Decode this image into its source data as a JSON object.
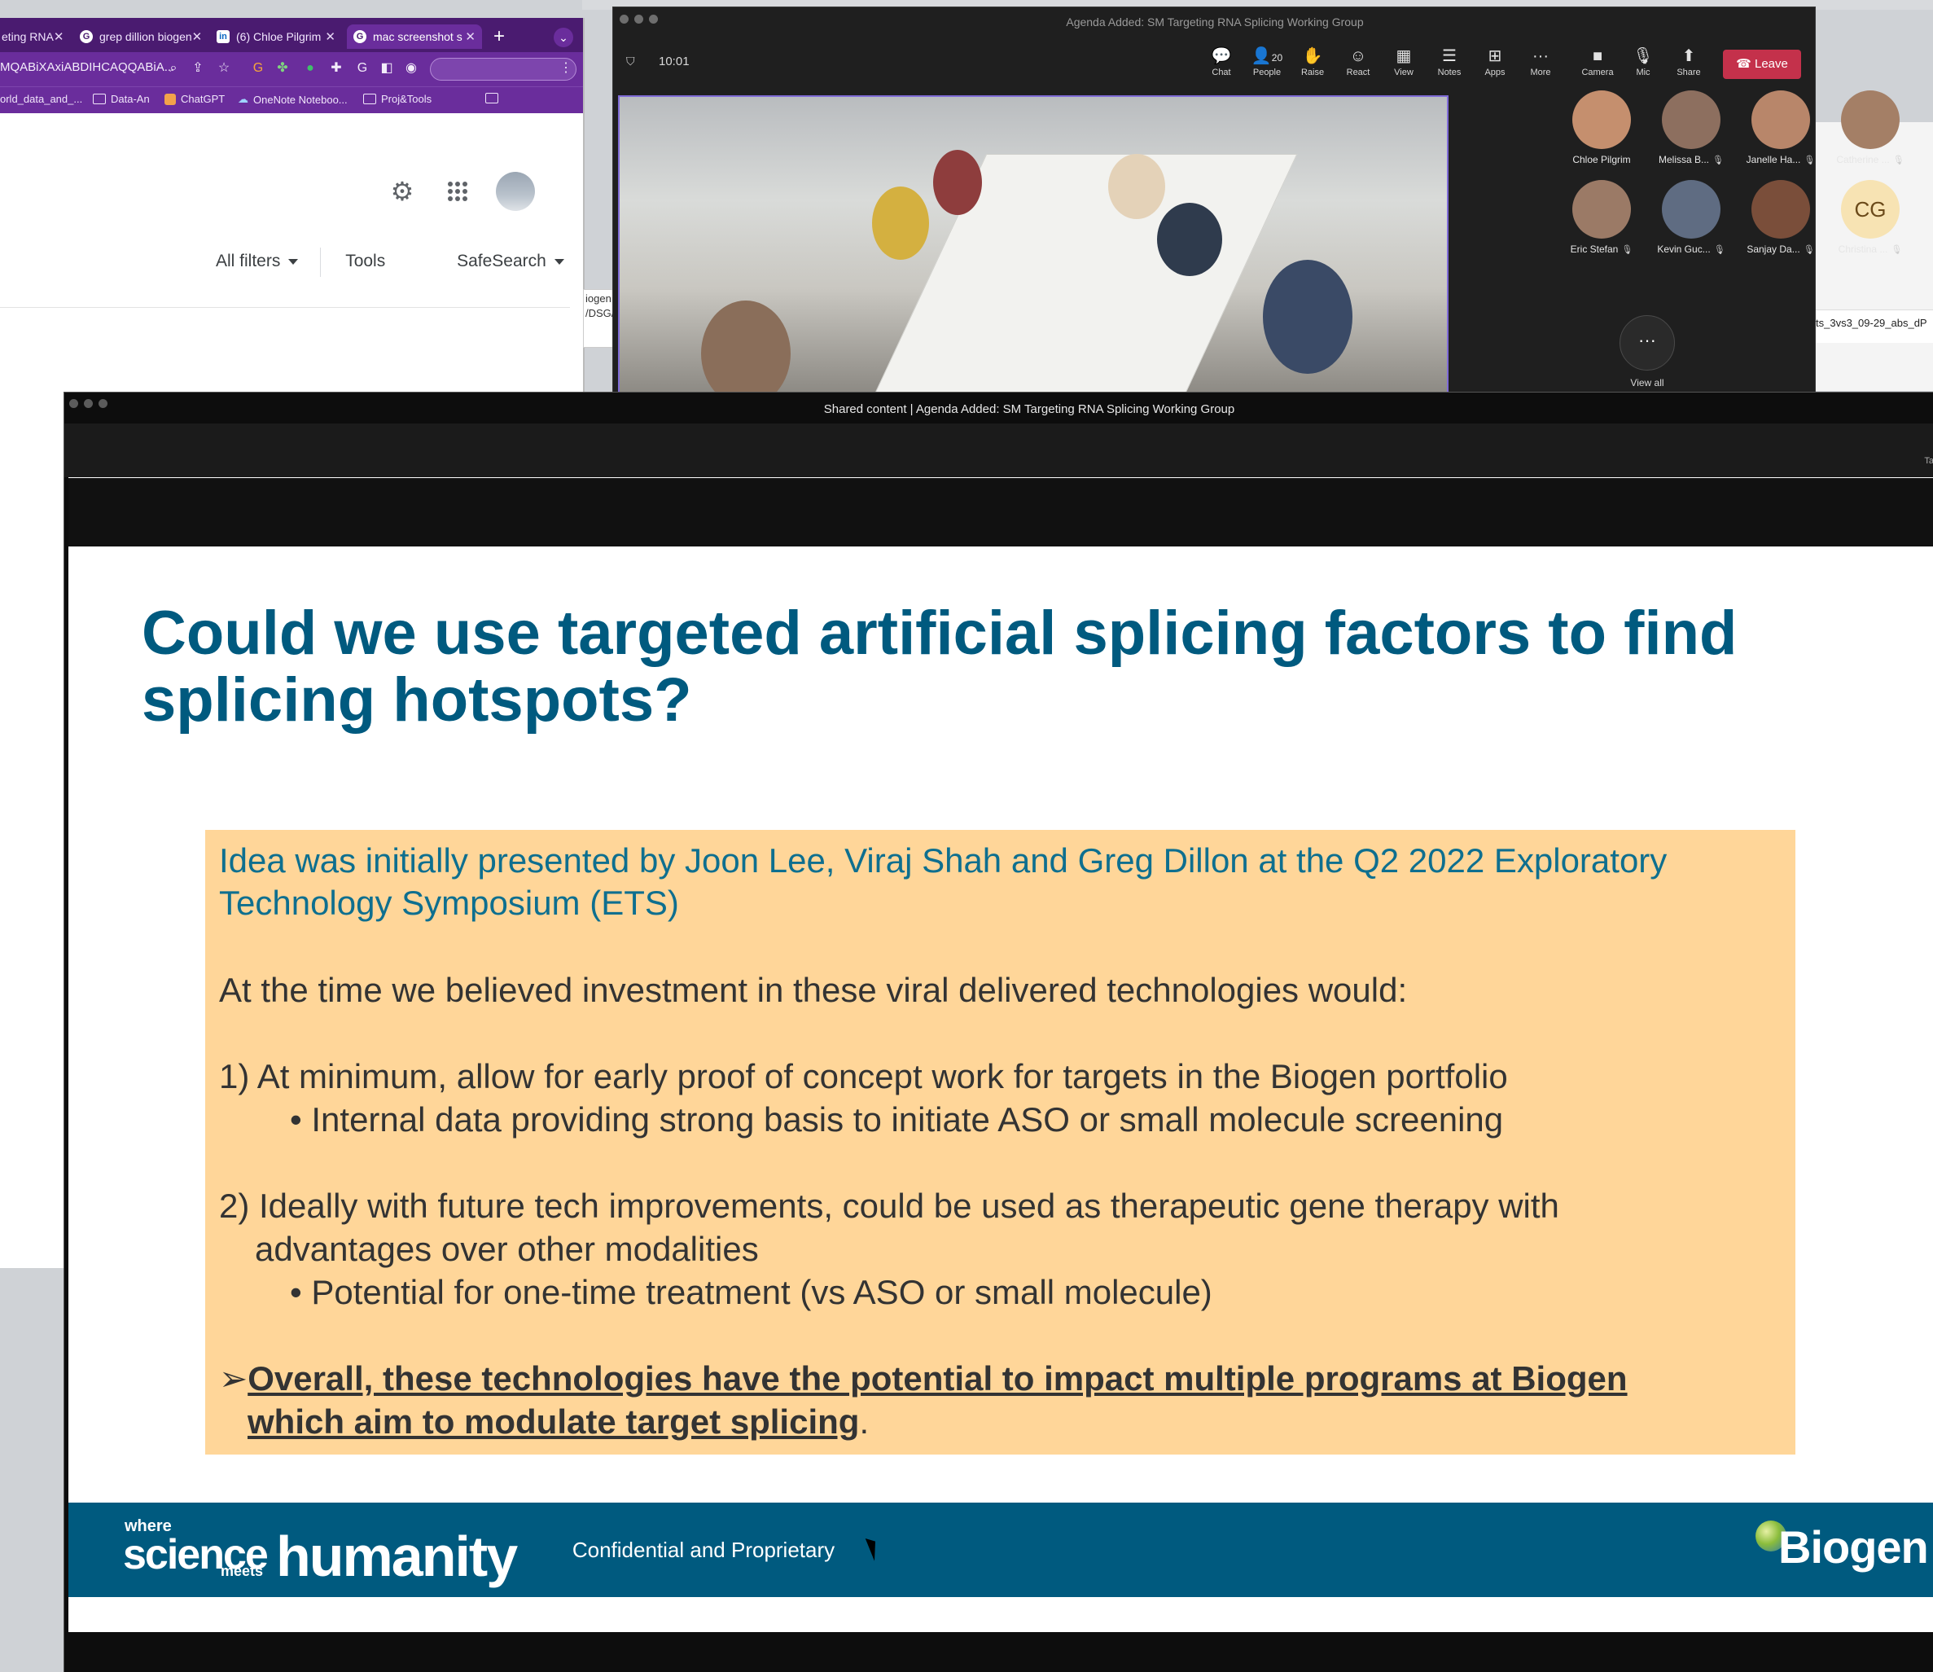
{
  "browser": {
    "tabs": [
      {
        "label": "eting RNA",
        "icon": "G"
      },
      {
        "label": "grep dillion biogen",
        "icon": "G"
      },
      {
        "label": "(6) Chloe Pilgrim",
        "icon": "in"
      },
      {
        "label": "mac screenshot s",
        "icon": "G",
        "active": true
      }
    ],
    "url_text": "MQABiXAxiABDIHCAQQABiA...",
    "bookmarks": [
      "orld_data_and_...",
      "Data-An",
      "ChatGPT",
      "OneNote Noteboo...",
      "Proj&Tools"
    ],
    "filters": {
      "all_filters": "All filters",
      "tools": "Tools",
      "safesearch": "SafeSearch"
    }
  },
  "mid_window": {
    "line1": "iogen",
    "line2": "/DSG/"
  },
  "right_window": {
    "line1": "ts_3vs3_09-29_abs_dP"
  },
  "teams": {
    "title": "Agenda Added: SM Targeting RNA Splicing Working Group",
    "timer": "10:01",
    "toolbar": [
      {
        "label": "Chat",
        "icon": "chat-icon",
        "glyph": "💬"
      },
      {
        "label": "People",
        "icon": "people-icon",
        "glyph": "👤",
        "count": "20"
      },
      {
        "label": "Raise",
        "icon": "raise-hand-icon",
        "glyph": "✋"
      },
      {
        "label": "React",
        "icon": "react-icon",
        "glyph": "☺"
      },
      {
        "label": "View",
        "icon": "view-icon",
        "glyph": "▦"
      },
      {
        "label": "Notes",
        "icon": "notes-icon",
        "glyph": "☰"
      },
      {
        "label": "Apps",
        "icon": "apps-icon",
        "glyph": "⊞"
      },
      {
        "label": "More",
        "icon": "more-icon",
        "glyph": "···"
      },
      {
        "label": "Camera",
        "icon": "camera-off-icon",
        "glyph": "■"
      },
      {
        "label": "Mic",
        "icon": "mic-off-icon",
        "glyph": "🎙"
      },
      {
        "label": "Share",
        "icon": "share-icon",
        "glyph": "⬆"
      }
    ],
    "leave_label": "Leave",
    "participants": [
      {
        "name": "Chloe Pilgrim",
        "muted": false,
        "color": "#c58f6e"
      },
      {
        "name": "Melissa B...",
        "muted": true,
        "color": "#8d6f5f"
      },
      {
        "name": "Janelle Ha...",
        "muted": true,
        "color": "#b8866a"
      },
      {
        "name": "Catherine ...",
        "muted": true,
        "color": "#a47f66"
      },
      {
        "name": "Eric Stefan",
        "muted": true,
        "color": "#9b7a66"
      },
      {
        "name": "Kevin Guc...",
        "muted": true,
        "color": "#5f6c82"
      },
      {
        "name": "Sanjay Da...",
        "muted": true,
        "color": "#7a4e3a"
      },
      {
        "name": "Christina ...",
        "muted": true,
        "initials": "CG",
        "color": "#f7e3b3"
      }
    ],
    "view_all_label": "View all"
  },
  "shared": {
    "title": "Shared content | Agenda Added: SM Targeting RNA Splicing Working Group",
    "top_right_text": "Ta",
    "slide": {
      "title_line1": "Could we use targeted artificial splicing factors to find",
      "title_line2": "splicing hotspots?",
      "box": {
        "intro_line1": "Idea was initially presented by Joon Lee, Viraj Shah and Greg Dillon at the Q2 2022 Exploratory",
        "intro_line2": "Technology Symposium (ETS)",
        "belief": "At the time we believed investment in these viral delivered technologies would:",
        "item1": "1) At minimum, allow for early proof of concept work for targets in the Biogen portfolio",
        "item1_bullet": "• Internal data providing strong basis to initiate ASO or small molecule screening",
        "item2_line1": "2) Ideally with future tech improvements, could be used as therapeutic gene therapy with",
        "item2_line2": "advantages over other modalities",
        "item2_bullet": "•  Potential for one-time treatment (vs ASO or small molecule)",
        "arrow": "➢",
        "conclusion_line1": "Overall, these technologies have the potential to impact multiple programs at Biogen",
        "conclusion_line2": "which aim to modulate target splicing",
        "conclusion_period": "."
      },
      "footer": {
        "tagline_where": "where",
        "tagline_science": "science",
        "tagline_meets": "meets",
        "tagline_humanity": "humanity",
        "center": "Confidential and Proprietary",
        "logo": "Biogen"
      }
    }
  },
  "colors": {
    "slide_title": "#005a7f",
    "callout_bg": "#ffd699",
    "footer_bg": "#005a7f",
    "leave_bg": "#c4314b",
    "browser_tab": "#4a1b70"
  }
}
